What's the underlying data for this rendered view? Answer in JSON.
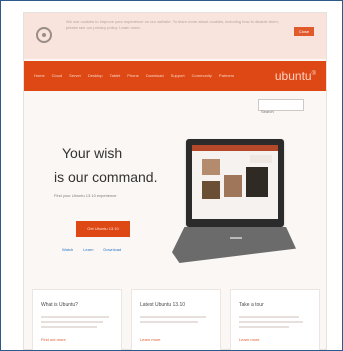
{
  "notice": {
    "text": "We use cookies to improve your experience on our website. To learn more about cookies, including how to disable them, please see our privacy policy. Learn more.",
    "button_label": "Close"
  },
  "nav": {
    "items": [
      "Home",
      "Cloud",
      "Server",
      "Desktop",
      "Tablet",
      "Phone",
      "Download",
      "Support",
      "Community",
      "Partners"
    ],
    "brand": "ubuntu",
    "brand_superscript": "®"
  },
  "search": {
    "placeholder": "Search"
  },
  "hero": {
    "headline_line1": "Your wish",
    "headline_line2": "is our command.",
    "subtext": "Find your Ubuntu 13.10 experience",
    "cta_label": "Get Ubuntu 13.10",
    "links": [
      "Watch",
      "Learn",
      "Download"
    ]
  },
  "columns": [
    {
      "title": "What is Ubuntu?",
      "more": "Find out more"
    },
    {
      "title": "Latest Ubuntu 13.10",
      "more": "Learn more"
    },
    {
      "title": "Take a tour",
      "more": "Learn more"
    }
  ],
  "colors": {
    "accent": "#dd4814",
    "notice_bg": "#f8e3dd",
    "frame": "#2d5a8a"
  }
}
